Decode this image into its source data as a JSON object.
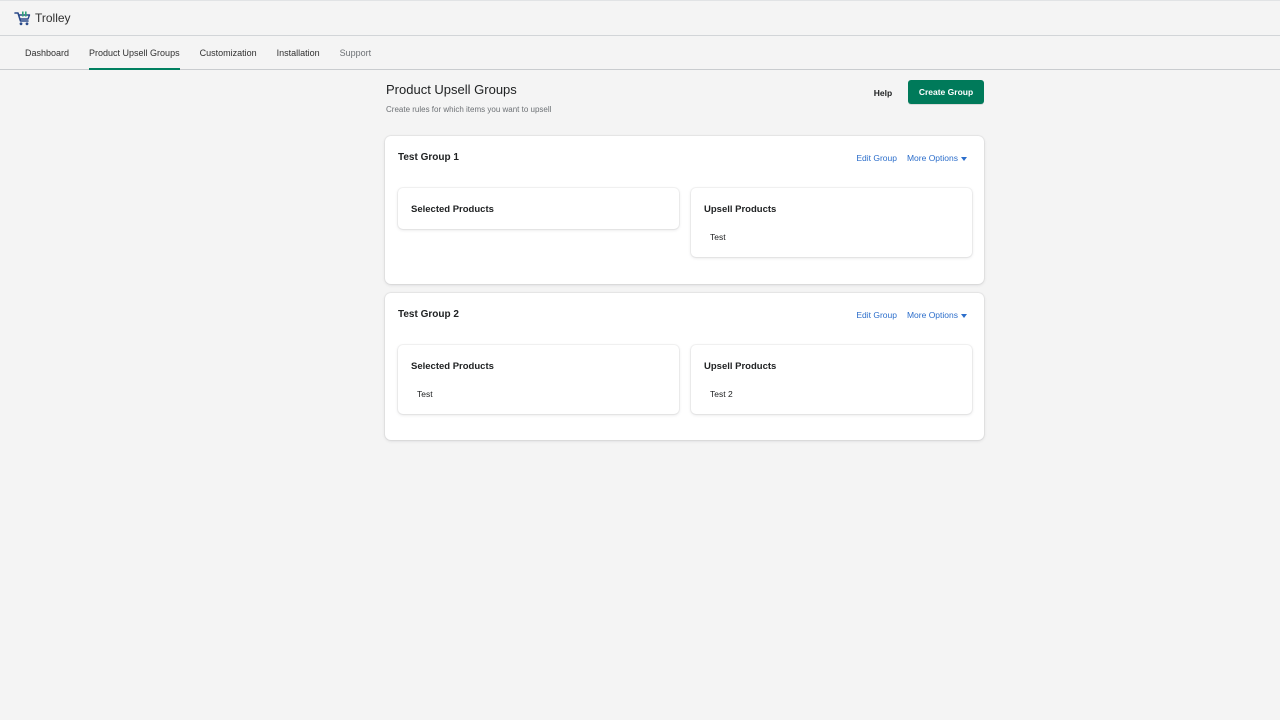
{
  "app": {
    "name": "Trolley",
    "logo_icon": "cart-icon",
    "accent": "#008060",
    "link_color": "#2c6ecb"
  },
  "nav": {
    "tabs": [
      {
        "label": "Dashboard"
      },
      {
        "label": "Product Upsell Groups",
        "active": true
      },
      {
        "label": "Customization"
      },
      {
        "label": "Installation"
      },
      {
        "label": "Support"
      }
    ]
  },
  "page": {
    "title": "Product Upsell Groups",
    "subtitle": "Create rules for which items you want to upsell",
    "help_label": "Help",
    "create_label": "Create Group"
  },
  "groups": [
    {
      "title": "Test Group 1",
      "edit_label": "Edit Group",
      "more_label": "More Options",
      "selected": {
        "title": "Selected Products",
        "items": []
      },
      "upsell": {
        "title": "Upsell Products",
        "items": [
          "Test"
        ]
      }
    },
    {
      "title": "Test Group 2",
      "edit_label": "Edit Group",
      "more_label": "More Options",
      "selected": {
        "title": "Selected Products",
        "items": [
          "Test"
        ]
      },
      "upsell": {
        "title": "Upsell Products",
        "items": [
          "Test 2"
        ]
      }
    }
  ]
}
